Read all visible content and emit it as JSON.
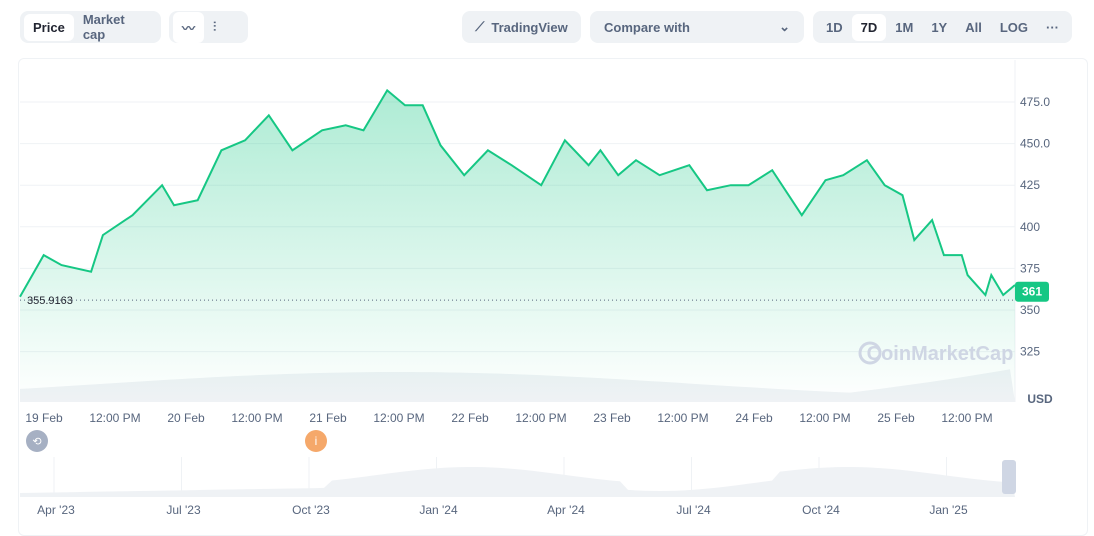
{
  "toolbar": {
    "price": "Price",
    "market_cap": "Market cap",
    "line_icon": "line-chart-icon",
    "candle_icon": "candlestick-icon",
    "tradingview": "TradingView",
    "compare": "Compare with",
    "ranges": [
      "1D",
      "7D",
      "1M",
      "1Y",
      "All"
    ],
    "log": "LOG",
    "more": "···",
    "active_range": "7D"
  },
  "chart_data": {
    "type": "area",
    "title": "",
    "xlabel": "",
    "ylabel": "USD",
    "ylim": [
      315,
      485
    ],
    "yticks": [
      "325",
      "350",
      "375",
      "400",
      "425",
      "450.0",
      "475.0"
    ],
    "xticks": [
      "19 Feb",
      "12:00 PM",
      "20 Feb",
      "12:00 PM",
      "21 Feb",
      "12:00 PM",
      "22 Feb",
      "12:00 PM",
      "23 Feb",
      "12:00 PM",
      "24 Feb",
      "12:00 PM",
      "25 Feb",
      "12:00 PM"
    ],
    "grid": true,
    "line_color": "#16c784",
    "current_price": "361",
    "reference_price": "355.9163",
    "watermark": "CoinMarketCap",
    "series": [
      {
        "x": [
          "2025-02-18 20:00",
          "2025-02-19 00:00",
          "2025-02-19 03:00",
          "2025-02-19 08:00",
          "2025-02-19 10:00",
          "2025-02-19 15:00",
          "2025-02-19 20:00",
          "2025-02-19 22:00",
          "2025-02-20 02:00",
          "2025-02-20 06:00",
          "2025-02-20 10:00",
          "2025-02-20 14:00",
          "2025-02-20 18:00",
          "2025-02-20 23:00",
          "2025-02-21 03:00",
          "2025-02-21 06:00",
          "2025-02-21 10:00",
          "2025-02-21 13:00",
          "2025-02-21 16:00",
          "2025-02-21 19:00",
          "2025-02-21 23:00",
          "2025-02-22 03:00",
          "2025-02-22 07:00",
          "2025-02-22 12:00",
          "2025-02-22 16:00",
          "2025-02-22 20:00",
          "2025-02-22 22:00",
          "2025-02-23 01:00",
          "2025-02-23 04:00",
          "2025-02-23 08:00",
          "2025-02-23 13:00",
          "2025-02-23 16:00",
          "2025-02-23 20:00",
          "2025-02-23 23:00",
          "2025-02-24 03:00",
          "2025-02-24 08:00",
          "2025-02-24 12:00",
          "2025-02-24 15:00",
          "2025-02-24 19:00",
          "2025-02-24 22:00",
          "2025-02-25 01:00",
          "2025-02-25 03:00",
          "2025-02-25 06:00",
          "2025-02-25 08:00",
          "2025-02-25 11:00",
          "2025-02-25 12:00",
          "2025-02-25 15:00",
          "2025-02-25 16:00",
          "2025-02-25 18:00",
          "2025-02-25 20:00"
        ],
        "y": [
          358,
          383,
          377,
          373,
          395,
          407,
          425,
          413,
          416,
          446,
          452,
          467,
          446,
          458,
          461,
          458,
          482,
          473,
          473,
          449,
          431,
          446,
          437,
          425,
          452,
          437,
          446,
          431,
          440,
          431,
          437,
          422,
          425,
          425,
          434,
          407,
          428,
          431,
          440,
          425,
          419,
          392,
          404,
          383,
          383,
          371,
          359,
          371,
          359,
          365
        ]
      }
    ]
  },
  "navigator": {
    "ticks": [
      "Apr '23",
      "Jul '23",
      "Oct '23",
      "Jan '24",
      "Apr '24",
      "Jul '24",
      "Oct '24",
      "Jan '25"
    ]
  },
  "markers": {
    "history_icon": "history-icon",
    "info_icon": "info-icon",
    "info_label": "i"
  }
}
